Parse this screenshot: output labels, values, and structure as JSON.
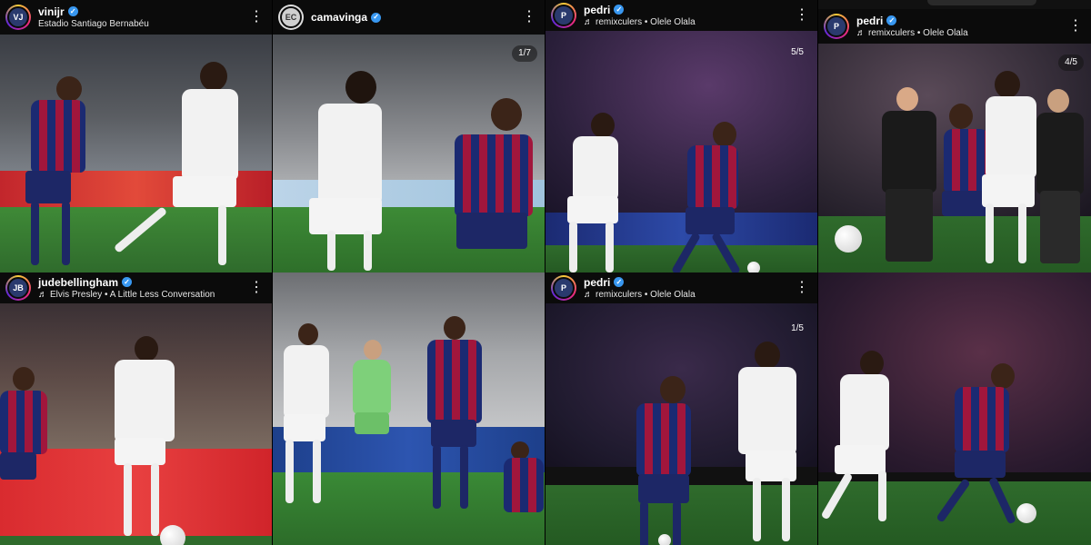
{
  "posts": [
    {
      "username": "vinijr",
      "subtitle": "Estadio Santiago Bernabéu",
      "has_music": false,
      "verified": true,
      "counter": "",
      "avatar_initials": "VJ"
    },
    {
      "username": "camavinga",
      "subtitle": "",
      "has_music": false,
      "verified": true,
      "counter": "1/7",
      "avatar_initials": "EC"
    },
    {
      "username": "pedri",
      "subtitle": "remixculers • Olele Olala",
      "has_music": true,
      "verified": true,
      "counter": "5/5",
      "avatar_initials": "P"
    },
    {
      "username": "pedri",
      "subtitle": "remixculers • Olele Olala",
      "has_music": true,
      "verified": true,
      "counter": "4/5",
      "avatar_initials": "P"
    },
    {
      "username": "judebellingham",
      "subtitle": "Elvis Presley • A Little Less Conversation",
      "has_music": true,
      "verified": true,
      "counter": "",
      "avatar_initials": "JB"
    },
    {
      "username": "",
      "subtitle": "",
      "has_music": false,
      "verified": false,
      "counter": "",
      "avatar_initials": ""
    },
    {
      "username": "pedri",
      "subtitle": "remixculers • Olele Olala",
      "has_music": true,
      "verified": true,
      "counter": "1/5",
      "avatar_initials": "P"
    },
    {
      "username": "",
      "subtitle": "",
      "has_music": false,
      "verified": false,
      "counter": "",
      "avatar_initials": ""
    }
  ],
  "icons": {
    "more": "⋮",
    "music": "♬",
    "verified": "✓"
  },
  "colors": {
    "verified_blue": "#3897f0",
    "barca_blue": "#1b2a72",
    "barca_red": "#a1163c",
    "madrid_white": "#f2f2f2",
    "pitch_green": "#2f6b2c"
  }
}
